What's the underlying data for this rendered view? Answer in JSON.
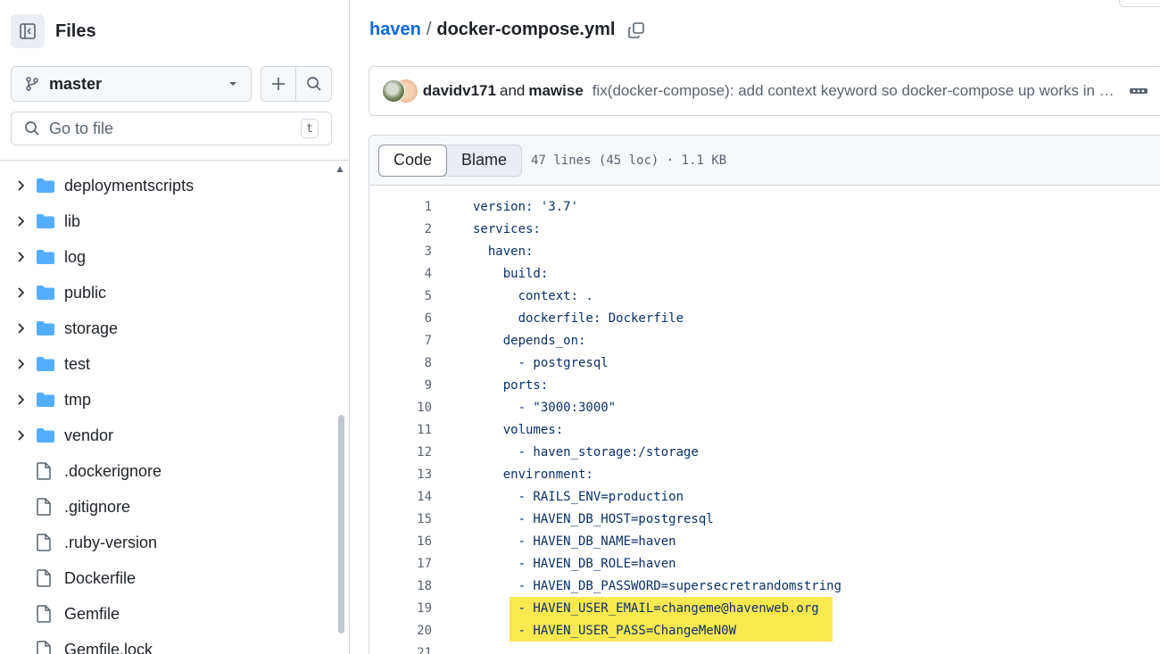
{
  "sidebar": {
    "title": "Files",
    "branch": "master",
    "goto_placeholder": "Go to file",
    "goto_shortcut": "t",
    "items": [
      {
        "label": "deploymentscripts",
        "type": "folder"
      },
      {
        "label": "lib",
        "type": "folder"
      },
      {
        "label": "log",
        "type": "folder"
      },
      {
        "label": "public",
        "type": "folder"
      },
      {
        "label": "storage",
        "type": "folder"
      },
      {
        "label": "test",
        "type": "folder"
      },
      {
        "label": "tmp",
        "type": "folder"
      },
      {
        "label": "vendor",
        "type": "folder"
      },
      {
        "label": ".dockerignore",
        "type": "file"
      },
      {
        "label": ".gitignore",
        "type": "file"
      },
      {
        "label": ".ruby-version",
        "type": "file"
      },
      {
        "label": "Dockerfile",
        "type": "file"
      },
      {
        "label": "Gemfile",
        "type": "file"
      },
      {
        "label": "Gemfile.lock",
        "type": "file"
      }
    ]
  },
  "breadcrumb": {
    "repo": "haven",
    "separator": "/",
    "file": "docker-compose.yml"
  },
  "commit": {
    "author1": "davidv171",
    "and": "and",
    "author2": "mawise",
    "message": "fix(docker-compose): add context keyword so docker-compose up works in production"
  },
  "code_view": {
    "tab_code": "Code",
    "tab_blame": "Blame",
    "meta": "47 lines (45 loc) · 1.1 KB",
    "highlight_color": "#fae84f",
    "lines": [
      {
        "n": "1",
        "text": "version: '3.7'"
      },
      {
        "n": "2",
        "text": "services:"
      },
      {
        "n": "3",
        "text": "  haven:"
      },
      {
        "n": "4",
        "text": "    build:"
      },
      {
        "n": "5",
        "text": "      context: ."
      },
      {
        "n": "6",
        "text": "      dockerfile: Dockerfile"
      },
      {
        "n": "7",
        "text": "    depends_on:"
      },
      {
        "n": "8",
        "text": "      - postgresql"
      },
      {
        "n": "9",
        "text": "    ports:"
      },
      {
        "n": "10",
        "text": "      - \"3000:3000\""
      },
      {
        "n": "11",
        "text": "    volumes:"
      },
      {
        "n": "12",
        "text": "      - haven_storage:/storage"
      },
      {
        "n": "13",
        "text": "    environment:"
      },
      {
        "n": "14",
        "text": "      - RAILS_ENV=production"
      },
      {
        "n": "15",
        "text": "      - HAVEN_DB_HOST=postgresql"
      },
      {
        "n": "16",
        "text": "      - HAVEN_DB_NAME=haven"
      },
      {
        "n": "17",
        "text": "      - HAVEN_DB_ROLE=haven"
      },
      {
        "n": "18",
        "text": "      - HAVEN_DB_PASSWORD=supersecretrandomstring"
      },
      {
        "n": "19",
        "text": "      - HAVEN_USER_EMAIL=changeme@havenweb.org",
        "highlight": true
      },
      {
        "n": "20",
        "text": "      - HAVEN_USER_PASS=ChangeMeN0W",
        "highlight": true
      },
      {
        "n": "21",
        "text": ""
      }
    ]
  }
}
